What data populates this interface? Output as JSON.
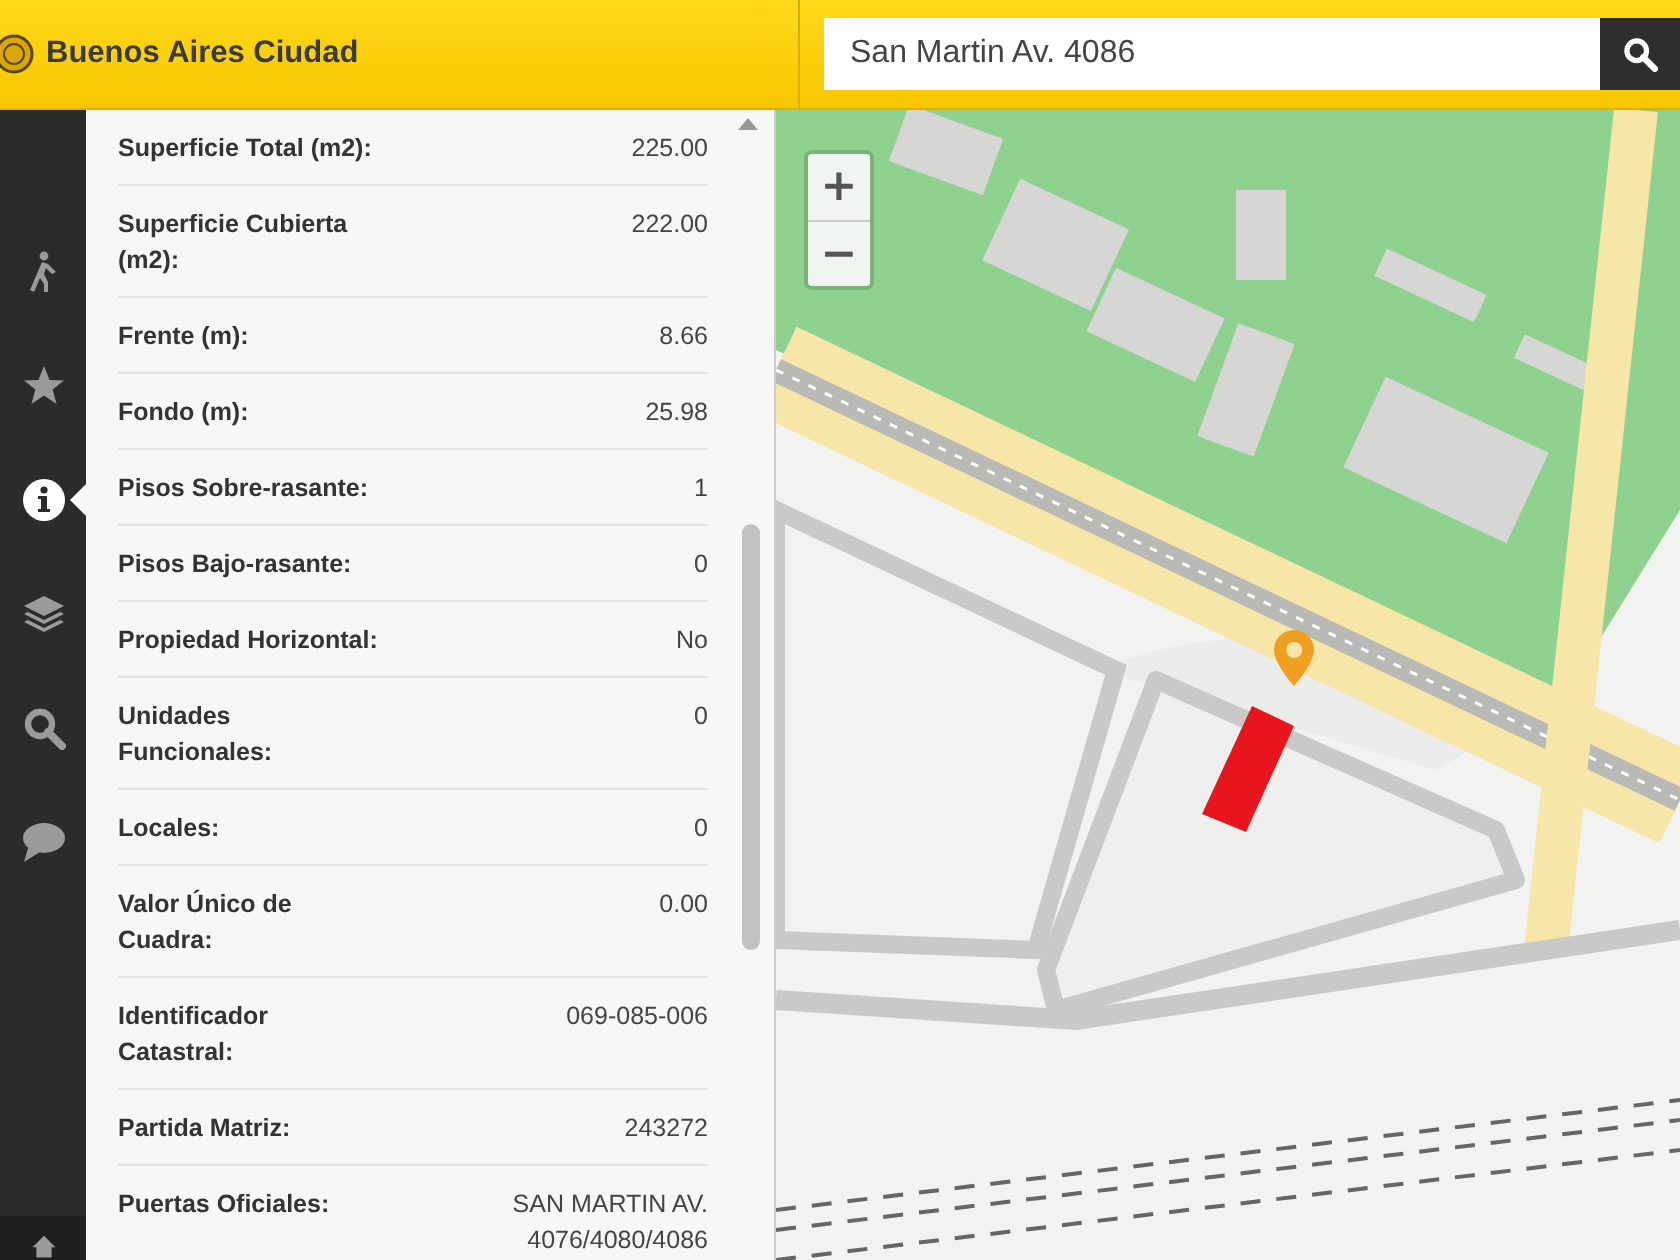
{
  "header": {
    "title": "Buenos Aires Ciudad",
    "search": {
      "value": "San Martin Av. 4086"
    }
  },
  "sidebar": {
    "items": [
      {
        "kind": "walker",
        "selected": false
      },
      {
        "kind": "star",
        "selected": false
      },
      {
        "kind": "info",
        "selected": true
      },
      {
        "kind": "layers",
        "selected": false
      },
      {
        "kind": "search",
        "selected": false
      },
      {
        "kind": "chat",
        "selected": false
      },
      {
        "kind": "home",
        "selected": false
      }
    ]
  },
  "details": {
    "rows": [
      {
        "label": "Superficie Total (m2):",
        "value": "225.00"
      },
      {
        "label": "Superficie Cubierta\n(m2):",
        "value": "222.00"
      },
      {
        "label": "Frente (m):",
        "value": "8.66"
      },
      {
        "label": "Fondo (m):",
        "value": "25.98"
      },
      {
        "label": "Pisos Sobre-rasante:",
        "value": "1"
      },
      {
        "label": "Pisos Bajo-rasante:",
        "value": "0"
      },
      {
        "label": "Propiedad Horizontal:",
        "value": "No"
      },
      {
        "label": "Unidades\nFuncionales:",
        "value": "0"
      },
      {
        "label": "Locales:",
        "value": "0"
      },
      {
        "label": "Valor Único de\nCuadra:",
        "value": "0.00"
      },
      {
        "label": "Identificador\nCatastral:",
        "value": "069-085-006"
      },
      {
        "label": "Partida Matriz:",
        "value": "243272"
      },
      {
        "label": "Puertas Oficiales:",
        "value": "SAN MARTIN AV.\n4076/4080/4086"
      }
    ]
  },
  "map": {
    "zoom_controls": [
      "+",
      "−"
    ]
  }
}
